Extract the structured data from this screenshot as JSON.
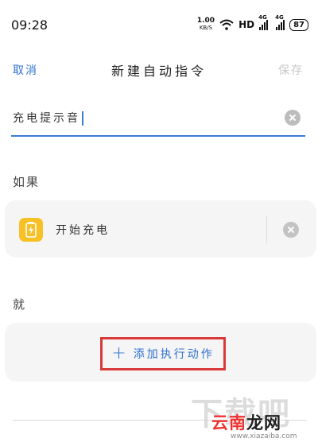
{
  "status_bar": {
    "time": "09:28",
    "net_speed_value": "1.00",
    "net_speed_unit": "KB/S",
    "hd": "HD",
    "signal1_label": "4G",
    "signal2_label": "4G",
    "battery": "87"
  },
  "header": {
    "cancel": "取消",
    "title": "新建自动指令",
    "save": "保存"
  },
  "name_input": {
    "value": "充电提示音"
  },
  "condition_section": {
    "label": "如果",
    "item": "开始充电",
    "icon": "battery-charging-icon"
  },
  "action_section": {
    "label": "就",
    "add_button": "添加执行动作"
  },
  "watermark": {
    "big": "下载吧",
    "logo_a": "云南",
    "logo_b": "龙网",
    "url": "www.xiazaiba.com"
  },
  "colors": {
    "accent": "#2e6fd0",
    "highlight_box": "#d83a3a",
    "condition_icon_bg": "#f6c026"
  }
}
